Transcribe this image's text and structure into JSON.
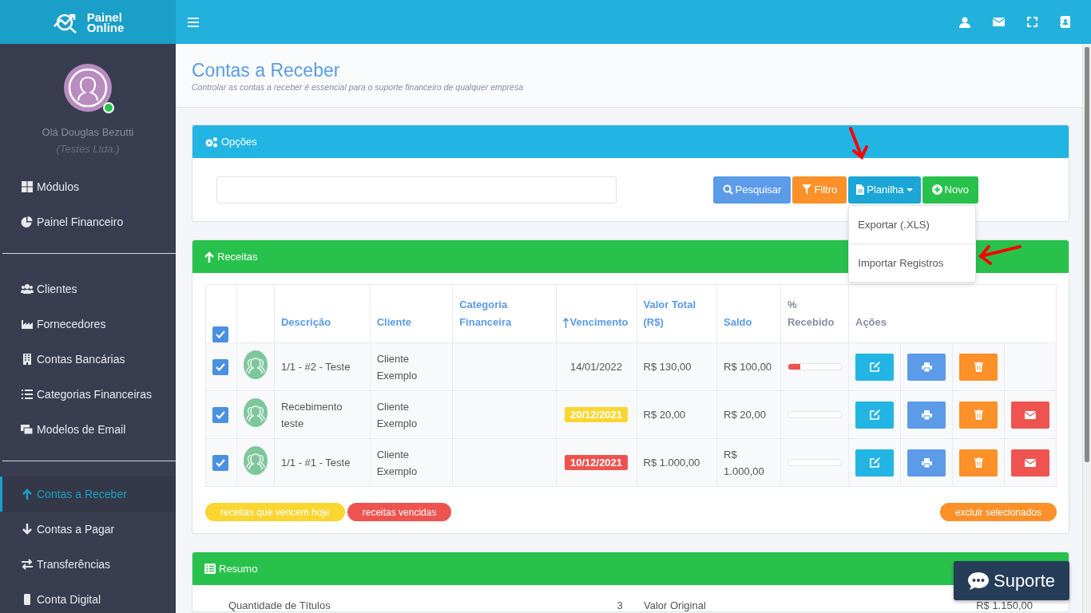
{
  "brand": {
    "line1": "Painel",
    "line2": "Online"
  },
  "user": {
    "greeting": "Olá Douglas Bezutti",
    "company": "(Testes Ltda.)",
    "online": true
  },
  "sidebar": {
    "groups": [
      {
        "items": [
          {
            "label": "Módulos",
            "selected": false
          },
          {
            "label": "Painel Financeiro",
            "selected": false
          }
        ]
      },
      {
        "items": [
          {
            "label": "Clientes",
            "selected": false
          },
          {
            "label": "Fornecedores",
            "selected": false
          },
          {
            "label": "Contas Bancárias",
            "selected": false
          },
          {
            "label": "Categorias Financeiras",
            "selected": false
          },
          {
            "label": "Modelos de Email",
            "selected": false
          }
        ]
      },
      {
        "items": [
          {
            "label": "Contas a Receber",
            "selected": true
          },
          {
            "label": "Contas a Pagar",
            "selected": false
          },
          {
            "label": "Transferências",
            "selected": false
          },
          {
            "label": "Conta Digital",
            "selected": false
          }
        ]
      }
    ]
  },
  "page": {
    "title": "Contas a Receber",
    "subtitle": "Controlar as contas a receber é essencial para o suporte financeiro de qualquer empresa"
  },
  "options": {
    "title": "Opções",
    "buttons": [
      {
        "label": "Pesquisar",
        "kind": "search"
      },
      {
        "label": "Filtro",
        "kind": "filter"
      },
      {
        "label": "Planilha",
        "kind": "sheet"
      },
      {
        "label": "Novo",
        "kind": "new"
      }
    ],
    "dropdown": {
      "expanded": true,
      "items": [
        "Exportar (.XLS)",
        "Importar Registros"
      ]
    }
  },
  "receitas": {
    "title": "Receitas",
    "all_checked": true,
    "columns": [
      {
        "label": "Descrição",
        "sortable": true,
        "sorted": false
      },
      {
        "label": "Cliente",
        "sortable": true,
        "sorted": false
      },
      {
        "label": "Categoria Financeira",
        "sortable": true,
        "sorted": false
      },
      {
        "label": "Vencimento",
        "sortable": true,
        "sorted": true
      },
      {
        "label": "Valor Total (R$)",
        "sortable": true,
        "sorted": false
      },
      {
        "label": "Saldo",
        "sortable": true,
        "sorted": false
      },
      {
        "label": "% Recebido",
        "sortable": false,
        "sorted": false
      },
      {
        "label": "Ações",
        "sortable": false,
        "sorted": false
      }
    ],
    "rows": [
      {
        "checked": true,
        "description": "1/1 - #2 - Teste",
        "client": "Cliente Exemplo",
        "due": {
          "text": "14/01/2022",
          "kind": "plain"
        },
        "total": "R$ 130,00",
        "balance": "R$ 100,00",
        "level": 0.23,
        "actions": [
          {
            "kind": "edit"
          },
          {
            "kind": "print"
          },
          {
            "kind": "delete"
          }
        ]
      },
      {
        "checked": true,
        "description": "Recebimento teste",
        "client": "Cliente Exemplo",
        "due": {
          "text": "20/12/2021",
          "kind": "today"
        },
        "total": "R$ 20,00",
        "balance": "R$ 20,00",
        "level": 0,
        "actions": [
          {
            "kind": "edit"
          },
          {
            "kind": "print"
          },
          {
            "kind": "delete"
          },
          {
            "kind": "email"
          }
        ]
      },
      {
        "checked": true,
        "description": "1/1 - #1 - Teste",
        "client": "Cliente Exemplo",
        "due": {
          "text": "10/12/2021",
          "kind": "overdue"
        },
        "total": "R$ 1.000,00",
        "balance": "R$ 1.000,00",
        "level": 0,
        "actions": [
          {
            "kind": "edit"
          },
          {
            "kind": "print"
          },
          {
            "kind": "delete"
          },
          {
            "kind": "email"
          }
        ]
      }
    ],
    "legend": [
      {
        "label": "receitas que vencem hoje",
        "color": "#fbd631"
      },
      {
        "label": "receitas vencidas",
        "color": "#ef5350"
      }
    ],
    "delete_selected": "excluir selecionados"
  },
  "resumo": {
    "title": "Resumo",
    "rows": [
      {
        "label": "Quantidade de Títulos",
        "count": "3",
        "label2": "Valor Original",
        "value": "R$ 1.150,00"
      }
    ]
  },
  "support": {
    "label": "Suporte"
  }
}
